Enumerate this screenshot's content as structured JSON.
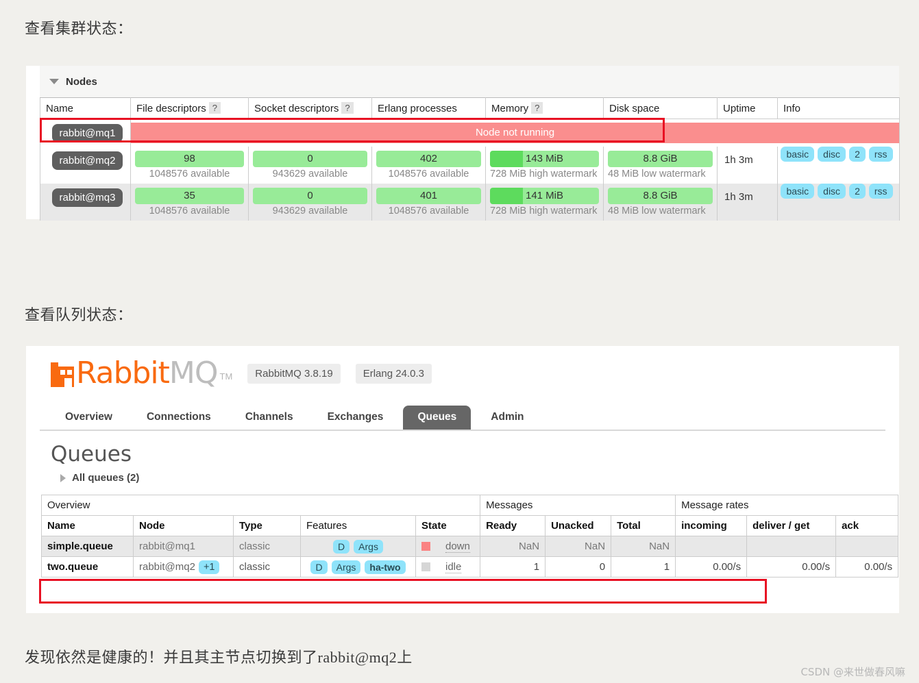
{
  "captions": {
    "cluster": "查看集群状态：",
    "queues": "查看队列状态：",
    "conclusion": "发现依然是健康的！并且其主节点切换到了rabbit@mq2上"
  },
  "watermark": "CSDN @来世做春风嘛",
  "nodes_panel": {
    "section_title": "Nodes",
    "columns": [
      {
        "label": "Name",
        "help": ""
      },
      {
        "label": "File descriptors",
        "help": "?"
      },
      {
        "label": "Socket descriptors",
        "help": "?"
      },
      {
        "label": "Erlang processes",
        "help": ""
      },
      {
        "label": "Memory",
        "help": "?"
      },
      {
        "label": "Disk space",
        "help": ""
      },
      {
        "label": "Uptime",
        "help": ""
      },
      {
        "label": "Info",
        "help": ""
      }
    ],
    "rows": [
      {
        "name": "rabbit@mq1",
        "status": "down",
        "down_message": "Node not running",
        "highlighted": true
      },
      {
        "name": "rabbit@mq2",
        "status": "running",
        "file_descriptors": {
          "value": "98",
          "sub": "1048576 available"
        },
        "socket_descriptors": {
          "value": "0",
          "sub": "943629 available"
        },
        "erlang_processes": {
          "value": "402",
          "sub": "1048576 available"
        },
        "memory": {
          "value": "143 MiB",
          "sub": "728 MiB high watermark",
          "fill_pct": 30
        },
        "disk_space": {
          "value": "8.8 GiB",
          "sub": "48 MiB low watermark",
          "fill_pct": 0
        },
        "uptime": "1h 3m",
        "info": [
          "basic",
          "disc",
          "2",
          "rss"
        ]
      },
      {
        "name": "rabbit@mq3",
        "status": "running",
        "file_descriptors": {
          "value": "35",
          "sub": "1048576 available"
        },
        "socket_descriptors": {
          "value": "0",
          "sub": "943629 available"
        },
        "erlang_processes": {
          "value": "401",
          "sub": "1048576 available"
        },
        "memory": {
          "value": "141 MiB",
          "sub": "728 MiB high watermark",
          "fill_pct": 30
        },
        "disk_space": {
          "value": "8.8 GiB",
          "sub": "48 MiB low watermark",
          "fill_pct": 0
        },
        "uptime": "1h 3m",
        "info": [
          "basic",
          "disc",
          "2",
          "rss"
        ]
      }
    ]
  },
  "mq_panel": {
    "brand": {
      "name_orange": "Rabbit",
      "name_grey": "MQ",
      "tm": "TM",
      "version_chip": "RabbitMQ 3.8.19",
      "erlang_chip": "Erlang 24.0.3"
    },
    "tabs": [
      {
        "label": "Overview",
        "active": false
      },
      {
        "label": "Connections",
        "active": false
      },
      {
        "label": "Channels",
        "active": false
      },
      {
        "label": "Exchanges",
        "active": false
      },
      {
        "label": "Queues",
        "active": true
      },
      {
        "label": "Admin",
        "active": false
      }
    ],
    "page_title": "Queues",
    "all_queues_label": "All queues (2)",
    "group_headers": {
      "overview": "Overview",
      "messages": "Messages",
      "message_rates": "Message rates"
    },
    "columns": {
      "name": "Name",
      "node": "Node",
      "type": "Type",
      "features": "Features",
      "state": "State",
      "ready": "Ready",
      "unacked": "Unacked",
      "total": "Total",
      "incoming": "incoming",
      "deliver_get": "deliver / get",
      "ack": "ack"
    },
    "rows": [
      {
        "name": "simple.queue",
        "node": "rabbit@mq1",
        "node_plus": "",
        "type": "classic",
        "features": [
          "D",
          "Args"
        ],
        "features_bold": [],
        "state": "down",
        "state_color": "red",
        "ready": "NaN",
        "unacked": "NaN",
        "total": "NaN",
        "incoming": "",
        "deliver_get": "",
        "ack": "",
        "highlighted": false
      },
      {
        "name": "two.queue",
        "node": "rabbit@mq2",
        "node_plus": "+1",
        "type": "classic",
        "features": [
          "D",
          "Args"
        ],
        "features_bold": [
          "ha-two"
        ],
        "state": "idle",
        "state_color": "grey",
        "ready": "1",
        "unacked": "0",
        "total": "1",
        "incoming": "0.00/s",
        "deliver_get": "0.00/s",
        "ack": "0.00/s",
        "highlighted": true
      }
    ]
  },
  "colors": {
    "brand_orange": "#f96a10",
    "bar_green_light": "#98eb98",
    "bar_green_dark": "#5ddb5d",
    "tag_blue": "#8fe3fa",
    "down_red": "#fa8e8e",
    "highlight_red": "#e81123"
  }
}
